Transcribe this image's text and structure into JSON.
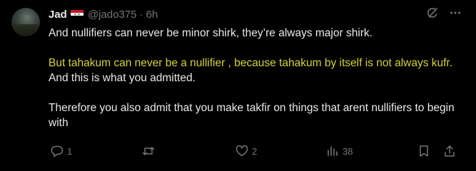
{
  "author": {
    "name": "Jad",
    "handle": "@jado375",
    "separator": "·",
    "time": "6h"
  },
  "flag_icon": "syria-flag-icon",
  "colors": {
    "background": "#000000",
    "text": "#e7e9ea",
    "muted": "#71767b",
    "highlight": "#d6d23a"
  },
  "body": {
    "p1": "And nullifiers can never be minor shirk, they’re always major shirk.",
    "p2_highlight": "But tahakum can never be a nullifier , because tahakum by itself is not always kufr.",
    "p2_rest": " And this is what you admitted.",
    "p3": "Therefore you also admit that you make takfir on things that arent nullifiers to begin with"
  },
  "actions": {
    "replies": "1",
    "retweets": "",
    "likes": "2",
    "views": "38"
  }
}
